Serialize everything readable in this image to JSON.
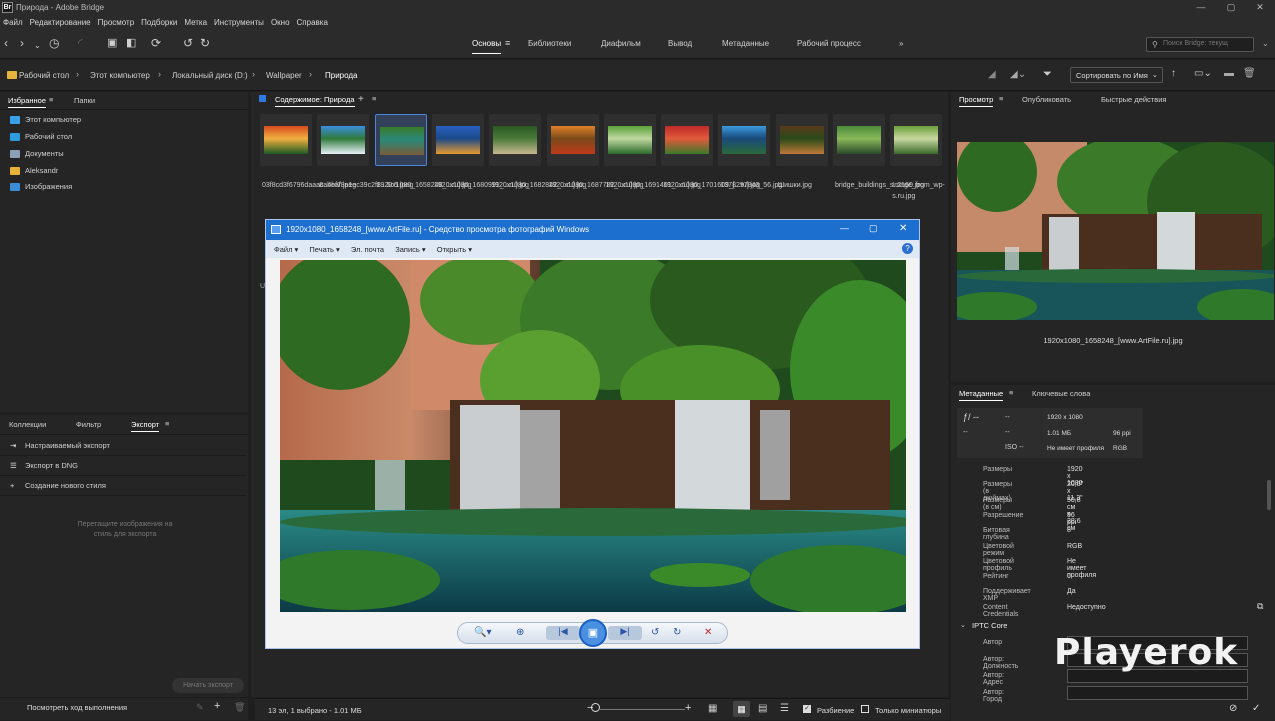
{
  "window": {
    "title": "Природа - Adobe Bridge",
    "logo": "Br",
    "minimize": "—",
    "maximize": "▢",
    "close": "✕"
  },
  "menu": [
    "Файл",
    "Редактирование",
    "Просмотр",
    "Подборки",
    "Метка",
    "Инструменты",
    "Окно",
    "Справка"
  ],
  "workspaces": {
    "tabs": [
      "Основы",
      "Библиотеки",
      "Диафильм",
      "Вывод",
      "Метаданные",
      "Рабочий процесс"
    ],
    "active": "Основы",
    "more": "»"
  },
  "search": {
    "placeholder": "Поиск Bridge: текущ"
  },
  "breadcrumb": [
    "Рабочий стол",
    "Этот компьютер",
    "Локальный диск (D:)",
    "Wallpaper",
    "Природа"
  ],
  "sort": {
    "label": "Сортировать по Имя"
  },
  "left_panel": {
    "tabs": [
      "Избранное",
      "Папки"
    ],
    "favorites": [
      {
        "label": "Этот компьютер",
        "color": "#3aa0e8"
      },
      {
        "label": "Рабочий стол",
        "color": "#2e9be0"
      },
      {
        "label": "Документы",
        "color": "#8aa0b8"
      },
      {
        "label": "Aleksandr",
        "color": "#e6b23a"
      },
      {
        "label": "Изображения",
        "color": "#3a8ed8"
      }
    ]
  },
  "export_panel": {
    "tabs": [
      "Коллекции",
      "Фильтр",
      "Экспорт"
    ],
    "items": [
      {
        "icon": "⇥",
        "label": "Настраиваемый экспорт"
      },
      {
        "icon": "☰",
        "label": "Экспорт в DNG"
      },
      {
        "icon": "+",
        "label": "Создание нового стиля"
      }
    ],
    "drop_hint": "Перетащите изображения на стиль для экспорта",
    "start_button": "Начать экспорт",
    "progress_link": "Посмотреть ход выполнения"
  },
  "content": {
    "title": "Содержимое: Природа",
    "stray_char": "U",
    "thumbnails": [
      {
        "caption": "03f8cd3f6796daaac..4bf7.jpeg",
        "c1": "#d64a1e",
        "c2": "#1c5a22",
        "c3": "#f0b040"
      },
      {
        "caption": "8abeaf8a1ec39c2f8...5c5.jpeg",
        "c1": "#3a8fe0",
        "c2": "#e8f2fa",
        "c3": "#2f7a3a"
      },
      {
        "caption": "1920x1080_1658248_...ru].jpg",
        "c1": "#3a7a2a",
        "c2": "#7a5a3a",
        "c3": "#2a8a7a",
        "selected": true
      },
      {
        "caption": "1920x1080_1680991_...ru].jpg",
        "c1": "#2a60c0",
        "c2": "#e89a30",
        "c3": "#1a4a8a"
      },
      {
        "caption": "1920x1080_1682842_...ru].jpg",
        "c1": "#2a5a22",
        "c2": "#c8b890",
        "c3": "#4a7a3a"
      },
      {
        "caption": "1920x1080_1687782_...ru].jpg",
        "c1": "#e0802a",
        "c2": "#c03a1a",
        "c3": "#7a4a1a"
      },
      {
        "caption": "1920x1080_1691461_...ru].jpg",
        "c1": "#5aa03a",
        "c2": "#2a6a2a",
        "c3": "#c0d8a0"
      },
      {
        "caption": "1920x1080_1701609_[...ru].jpg",
        "c1": "#c02a2a",
        "c2": "#3a7a2a",
        "c3": "#e05a3a"
      },
      {
        "caption": "1378297843_56.jpg",
        "c1": "#3a9ae0",
        "c2": "#2a6a3a",
        "c3": "#1a4a7a"
      },
      {
        "caption": "Шишки.jpg",
        "c1": "#5a3a1a",
        "c2": "#c07a3a",
        "c3": "#2a4a1a"
      },
      {
        "caption": "bridge_buildings_s..2160.jpg",
        "c1": "#4a8a3a",
        "c2": "#2a4a2a",
        "c3": "#8ab85a"
      },
      {
        "caption": "Image_from_wp-s.ru.jpg",
        "c1": "#6aa03a",
        "c2": "#3a6a2a",
        "c3": "#c8d8a0"
      }
    ]
  },
  "photo_viewer": {
    "title": "1920x1080_1658248_[www.ArtFile.ru] - Средство просмотра фотографий Windows",
    "menu": [
      "Файл ▾",
      "Печать ▾",
      "Эл. почта",
      "Запись ▾",
      "Открыть ▾"
    ],
    "help": "?",
    "controls": [
      "🔍▾",
      "⊕",
      "|◀",
      "▣",
      "▶|",
      "↺",
      "↻",
      "✕"
    ]
  },
  "preview_panel": {
    "tabs": [
      "Просмотр",
      "Опубликовать",
      "Быстрые действия"
    ],
    "filename": "1920x1080_1658248_[www.ArtFile.ru].jpg"
  },
  "metadata_panel": {
    "tabs": [
      "Метаданные",
      "Ключевые слова"
    ],
    "placard": {
      "aperture": "ƒ/ --",
      "dash1": "--",
      "dash2": "--",
      "dash3": "--",
      "iso": "ISO --",
      "dims": "1920 x 1080",
      "size": "1.01 МБ",
      "ppi": "96 ppi",
      "profile": "Не имеет профиля",
      "mode": "RGB"
    },
    "fields": [
      {
        "label": "Размеры",
        "value": "1920 x 1080"
      },
      {
        "label": "Размеры (в дюймах)",
        "value": "20,0\" x 11,3\""
      },
      {
        "label": "Размеры (в см)",
        "value": "50,8 см x 28,6 см"
      },
      {
        "label": "Разрешение",
        "value": "96 ppi"
      },
      {
        "label": "Битовая глубина",
        "value": "8"
      },
      {
        "label": "Цветовой режим",
        "value": "RGB"
      },
      {
        "label": "Цветовой профиль",
        "value": "Не имеет профиля"
      },
      {
        "label": "Рейтинг",
        "value": "0"
      },
      {
        "label": "Поддерживает XMP",
        "value": "Да"
      },
      {
        "label": "Content Credentials",
        "value": "Недоступно"
      }
    ],
    "iptc_section": "IPTC Core",
    "iptc_fields": [
      "Автор",
      "Автор: Должность",
      "Автор: Адрес",
      "Автор: Город"
    ]
  },
  "status_bar": {
    "text": "13 эл, 1 выбрано - 1.01 МБ",
    "split_label": "Разбиение",
    "thumbs_only_label": "Только миниатюры"
  },
  "watermark": "Playerok",
  "colors": {
    "accent": "#4b84d9",
    "viewer_title": "#1c6fcf"
  }
}
